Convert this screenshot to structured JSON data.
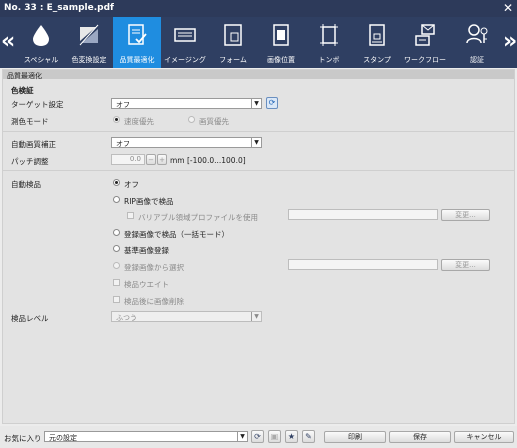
{
  "window": {
    "title": "No. 33 : E_sample.pdf"
  },
  "toolbar": {
    "tabs": [
      {
        "label": "スペシャル",
        "icon": "drop-icon"
      },
      {
        "label": "色変換設定",
        "icon": "color-palette-icon"
      },
      {
        "label": "品質最適化",
        "icon": "quality-check-icon",
        "active": true
      },
      {
        "label": "イメージング",
        "icon": "imaging-icon"
      },
      {
        "label": "フォーム",
        "icon": "form-icon"
      },
      {
        "label": "画像位置",
        "icon": "image-position-icon"
      },
      {
        "label": "トンボ",
        "icon": "crop-marks-icon"
      },
      {
        "label": "スタンプ",
        "icon": "stamp-icon"
      },
      {
        "label": "ワークフロー",
        "icon": "workflow-icon"
      },
      {
        "label": "認証",
        "icon": "authentication-icon"
      }
    ]
  },
  "section": {
    "title": "品質最適化"
  },
  "color_check": {
    "heading": "色検証",
    "target_label": "ターゲット設定",
    "target_value": "オフ",
    "mode_label": "測色モード",
    "mode_options": [
      "速度優先",
      "画質優先"
    ]
  },
  "auto_correction": {
    "label": "自動画質補正",
    "value": "オフ",
    "patch_label": "パッチ調整",
    "patch_value": "0.0",
    "patch_minus": "−",
    "patch_plus": "+",
    "patch_range": "mm [-100.0...100.0]"
  },
  "auto_inspection": {
    "label": "自動検品",
    "options": {
      "off": "オフ",
      "rip": "RIP画像で検品",
      "variable": "バリアブル領域プロファイルを使用",
      "registered_batch": "登録画像で検品（一括モード）",
      "register_base": "基準画像登録",
      "select_registered": "登録画像から選択",
      "inspection_wait": "検品ウエイト",
      "delete_after": "検品後に画像削除"
    },
    "change_button": "変更...",
    "change_button_2": "変更..."
  },
  "inspection_level": {
    "label": "検品レベル",
    "value": "ふつう"
  },
  "bottom": {
    "favorites_label": "お気に入り",
    "favorites_value": "元の設定",
    "print_button": "印刷",
    "save_button": "保存",
    "cancel_button": "キャンセル"
  },
  "colors": {
    "toolbar_bg": "#2f3f62",
    "active_tab": "#1f8de0",
    "titlebar_bg": "#2d3a5a"
  }
}
